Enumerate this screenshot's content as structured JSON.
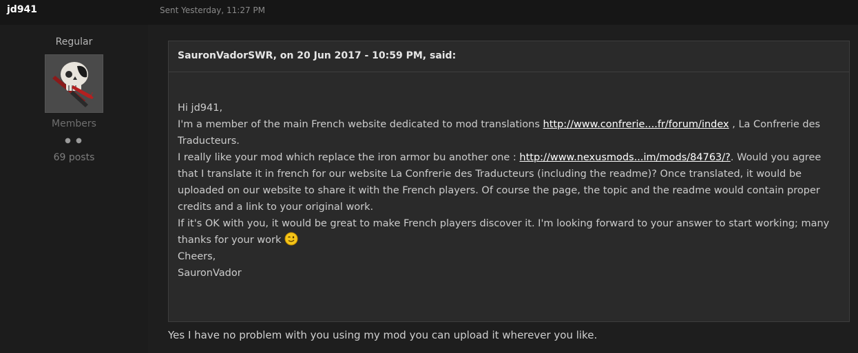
{
  "post": {
    "author": "jd941",
    "sent": "Sent Yesterday, 11:27 PM"
  },
  "author_panel": {
    "rank": "Regular",
    "avatar_icon": "skull-with-wrench-icon",
    "group": "Members",
    "pips": "● ●",
    "posts": "69 posts"
  },
  "quote": {
    "citation": "SauronVadorSWR, on 20 Jun 2017 - 10:59 PM, said:",
    "greeting": "Hi jd941,",
    "line1_before": "I'm a member of the main French website dedicated to mod translations ",
    "link1": "http://www.confrerie....fr/forum/index",
    "line1_after": " , La Confrerie des Traducteurs.",
    "line2_before": "I really like your mod which replace the iron armor bu another one : ",
    "link2": "http://www.nexusmods...im/mods/84763/?",
    "line2_after": ". Would you agree that I translate it in french for our website La Confrerie des Traducteurs (including the readme)? Once translated, it would be uploaded on our website to share it with the French players. Of course the page, the topic and the readme would contain proper credits and a link to your original work.",
    "line3": "If it's OK with you, it would be great to make French players discover it. I'm looking forward to your answer to start working; many thanks for your work ",
    "smiley_icon": "wink-smiley-icon",
    "cheers": "Cheers,",
    "signature": "SauronVador"
  },
  "reply": "Yes I have no problem with you using my mod you can upload it wherever you like.",
  "colors": {
    "background": "#1a1a1a",
    "quote_bg": "#2a2a2a",
    "link": "#ffffff"
  }
}
